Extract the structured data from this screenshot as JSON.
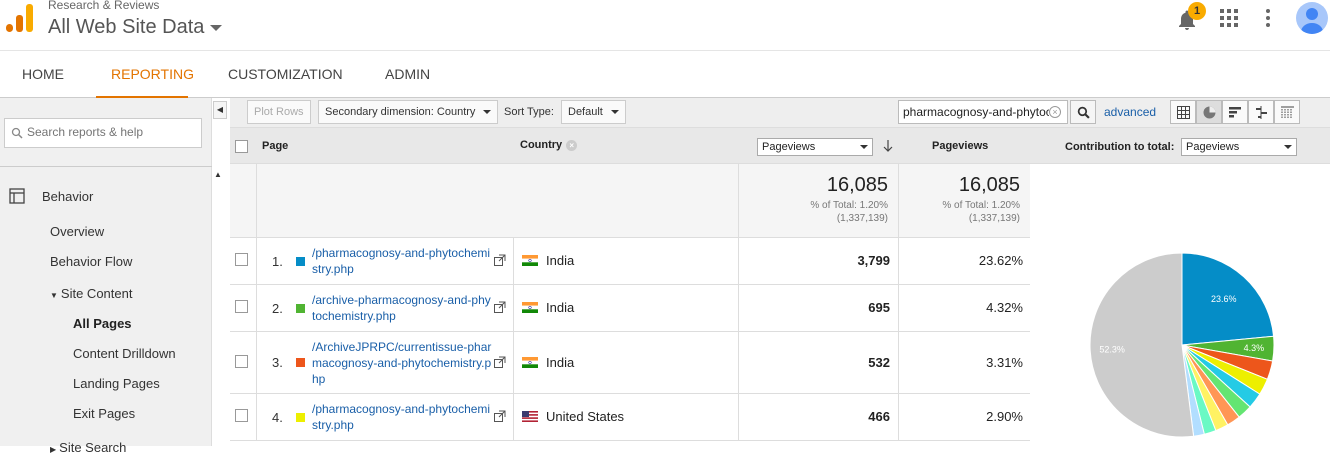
{
  "header": {
    "account": "Research & Reviews",
    "property": "All Web Site Data",
    "notification_count": "1"
  },
  "nav": {
    "tabs": [
      {
        "label": "HOME"
      },
      {
        "label": "REPORTING"
      },
      {
        "label": "CUSTOMIZATION"
      },
      {
        "label": "ADMIN"
      }
    ],
    "active_tab": "REPORTING"
  },
  "sidebar": {
    "search_placeholder": "Search reports & help",
    "section": "Behavior",
    "items": [
      {
        "label": "Overview"
      },
      {
        "label": "Behavior Flow"
      },
      {
        "label": "Site Content"
      },
      {
        "label": "All Pages"
      },
      {
        "label": "Content Drilldown"
      },
      {
        "label": "Landing Pages"
      },
      {
        "label": "Exit Pages"
      },
      {
        "label": "Site Search"
      }
    ]
  },
  "toolbar": {
    "plot_rows": "Plot Rows",
    "secondary_dimension": "Secondary dimension: Country",
    "sort_type_label": "Sort Type:",
    "sort_type_value": "Default",
    "filter_value": "pharmacognosy-and-phytoc",
    "advanced": "advanced"
  },
  "table": {
    "col_page": "Page",
    "col_country": "Country",
    "metric_select": "Pageviews",
    "col_pageviews": "Pageviews",
    "contribution_label": "Contribution to total:",
    "contribution_select": "Pageviews",
    "totals": {
      "value1": "16,085",
      "pct1": "% of Total: 1.20%",
      "total1": "(1,337,139)",
      "value2": "16,085",
      "pct2": "% of Total: 1.20%",
      "total2": "(1,337,139)"
    },
    "rows": [
      {
        "num": "1.",
        "page": "/pharmacognosy-and-phytochemistry.php",
        "country": "India",
        "flag": "in",
        "pageviews": "3,799",
        "pct": "23.62%",
        "color": "#058dc7"
      },
      {
        "num": "2.",
        "page": "/archive-pharmacognosy-and-phytochemistry.php",
        "country": "India",
        "flag": "in",
        "pageviews": "695",
        "pct": "4.32%",
        "color": "#50b432"
      },
      {
        "num": "3.",
        "page": "/ArchiveJPRPC/currentissue-pharmacognosy-and-phytochemistry.php",
        "country": "India",
        "flag": "in",
        "pageviews": "532",
        "pct": "3.31%",
        "color": "#ed561b"
      },
      {
        "num": "4.",
        "page": "/pharmacognosy-and-phytochemistry.php",
        "country": "United States",
        "flag": "us",
        "pageviews": "466",
        "pct": "2.90%",
        "color": "#edef00"
      }
    ]
  },
  "pie": {
    "label_first": "23.6%",
    "label_second": "4.3%",
    "label_other": "52.3%",
    "slices": [
      {
        "value": 23.62,
        "color": "#058dc7"
      },
      {
        "value": 4.32,
        "color": "#50b432"
      },
      {
        "value": 3.31,
        "color": "#ed561b"
      },
      {
        "value": 2.9,
        "color": "#edef00"
      },
      {
        "value": 2.8,
        "color": "#24cbe5"
      },
      {
        "value": 2.6,
        "color": "#64e572"
      },
      {
        "value": 2.4,
        "color": "#ff9655"
      },
      {
        "value": 2.3,
        "color": "#fff263"
      },
      {
        "value": 2.1,
        "color": "#6af9c4"
      },
      {
        "value": 1.9,
        "color": "#b2deff"
      },
      {
        "value": 52.3,
        "color": "#cccccc"
      }
    ]
  }
}
